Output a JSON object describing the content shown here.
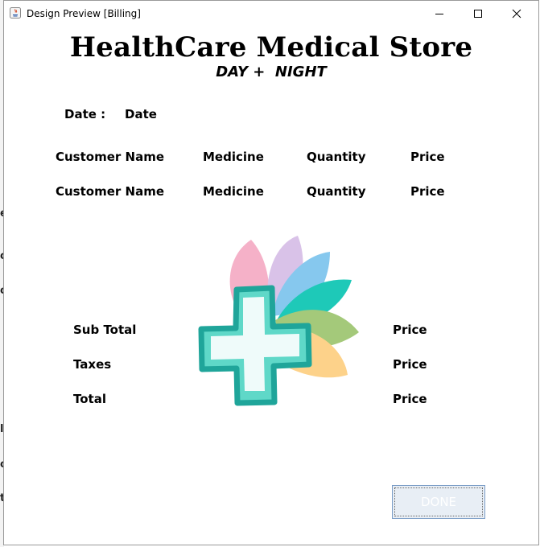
{
  "window": {
    "title": "Design Preview [Billing]"
  },
  "header": {
    "store_name": "HealthCare Medical Store",
    "tagline": "DAY +  NIGHT"
  },
  "date_row": {
    "label": "Date :",
    "value": "Date"
  },
  "items_header": {
    "customer": "Customer Name",
    "medicine": "Medicine",
    "quantity": "Quantity",
    "price": "Price"
  },
  "items": [
    {
      "customer": "Customer Name",
      "medicine": "Medicine",
      "quantity": "Quantity",
      "price": "Price"
    }
  ],
  "totals": [
    {
      "label": "Sub Total",
      "value": "Price"
    },
    {
      "label": "Taxes",
      "value": "Price"
    },
    {
      "label": "Total",
      "value": "Price"
    }
  ],
  "done_button": {
    "label": "DONE"
  },
  "colors": {
    "cross_fill": "#5fd8c8",
    "cross_outline": "#1fa59a",
    "petal_pink": "#f5b1c8",
    "petal_lavender": "#d9c2e8",
    "petal_blue": "#86c8ee",
    "petal_teal": "#1ec9b8",
    "petal_green": "#a4c97a",
    "petal_orange": "#fdd28a"
  }
}
